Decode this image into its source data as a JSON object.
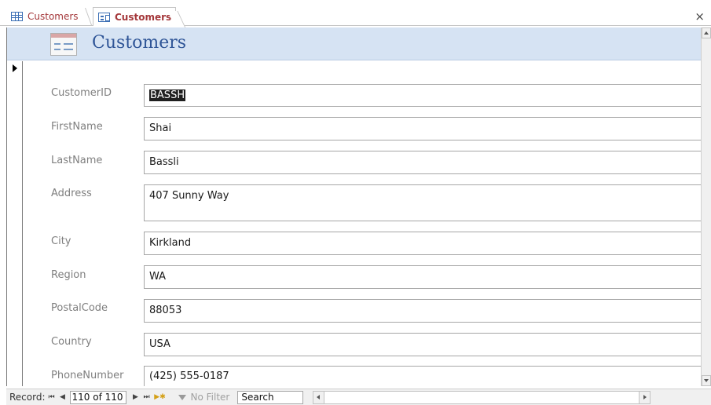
{
  "tabs": [
    {
      "label": "Customers",
      "icon": "table-icon",
      "active": false
    },
    {
      "label": "Customers",
      "icon": "form-icon",
      "active": true
    }
  ],
  "close_glyph": "×",
  "form": {
    "title": "Customers",
    "fields": [
      {
        "label": "CustomerID",
        "value": "BASSH"
      },
      {
        "label": "FirstName",
        "value": "Shai"
      },
      {
        "label": "LastName",
        "value": "Bassli"
      },
      {
        "label": "Address",
        "value": "407 Sunny Way"
      },
      {
        "label": "City",
        "value": "Kirkland"
      },
      {
        "label": "Region",
        "value": "WA"
      },
      {
        "label": "PostalCode",
        "value": "88053"
      },
      {
        "label": "Country",
        "value": "USA"
      },
      {
        "label": "PhoneNumber",
        "value": "(425) 555-0187"
      }
    ]
  },
  "navbar": {
    "record_label": "Record:",
    "first": "⏮",
    "prev": "◀",
    "current": "110 of 110",
    "next": "▶",
    "last": "⏭",
    "new_record": "▶✱",
    "filter_label": "No Filter",
    "search_value": "Search"
  },
  "colors": {
    "accent": "#a4373a",
    "header_band": "#d6e3f3",
    "title": "#2f5597"
  }
}
